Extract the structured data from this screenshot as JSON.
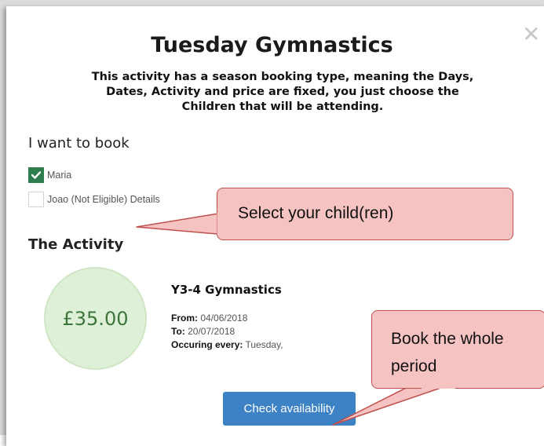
{
  "modal": {
    "title": "Tuesday Gymnastics",
    "description": "This activity has a season booking type, meaning the Days, Dates, Activity and price are fixed, you just choose the Children that will be attending.",
    "close_icon": "close-icon"
  },
  "booking": {
    "heading": "I want to book",
    "children": [
      {
        "label": "Maria",
        "checked": true
      },
      {
        "label": "Joao (Not Eligible) Details",
        "checked": false
      }
    ]
  },
  "activity": {
    "heading": "The Activity",
    "price": "£35.00",
    "name": "Y3-4 Gymnastics",
    "from_label": "From:",
    "from_value": "04/06/2018",
    "to_label": "To:",
    "to_value": "20/07/2018",
    "every_label": "Occuring every:",
    "every_value": "Tuesday,",
    "button_label": "Check availability"
  },
  "callouts": {
    "select": "Select your child(ren)",
    "book_line1": "Book the whole",
    "book_line2": "period"
  },
  "colors": {
    "accent_green": "#2e7d4f",
    "price_bg": "#dff0d8",
    "price_text": "#3c763d",
    "button_blue": "#3d82c4",
    "callout_fill": "#f6c3c3",
    "callout_border": "#c0504d"
  }
}
